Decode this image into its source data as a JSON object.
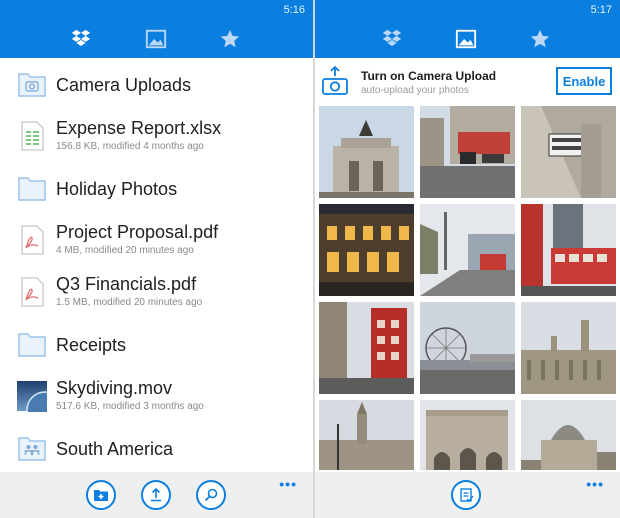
{
  "left": {
    "status_time": "5:16",
    "tabs": [
      {
        "name": "files",
        "icon": "dropbox-icon"
      },
      {
        "name": "photos",
        "icon": "photos-icon"
      },
      {
        "name": "favorites",
        "icon": "star-icon"
      }
    ],
    "files": [
      {
        "name": "Camera Uploads",
        "meta": "",
        "icon": "camera-folder-icon"
      },
      {
        "name": "Expense Report.xlsx",
        "meta": "156.8 KB, modified 4 months ago",
        "icon": "spreadsheet-icon"
      },
      {
        "name": "Holiday Photos",
        "meta": "",
        "icon": "folder-icon"
      },
      {
        "name": "Project Proposal.pdf",
        "meta": "4 MB, modified 20 minutes ago",
        "icon": "pdf-icon"
      },
      {
        "name": "Q3 Financials.pdf",
        "meta": "1.5 MB, modified 20 minutes ago",
        "icon": "pdf-icon"
      },
      {
        "name": "Receipts",
        "meta": "",
        "icon": "folder-icon"
      },
      {
        "name": "Skydiving.mov",
        "meta": "517.6 KB, modified 3 months ago",
        "icon": "video-thumbnail-icon"
      },
      {
        "name": "South America",
        "meta": "",
        "icon": "shared-folder-icon"
      }
    ],
    "app_bar": {
      "buttons": [
        "new-folder-icon",
        "upload-icon",
        "search-icon"
      ],
      "more": "•••"
    }
  },
  "right": {
    "status_time": "5:17",
    "banner": {
      "title": "Turn on Camera Upload",
      "subtitle": "auto-upload your photos",
      "enable_label": "Enable"
    },
    "app_bar": {
      "buttons": [
        "select-icon"
      ],
      "more": "•••"
    }
  },
  "colors": {
    "accent": "#0a7fe0",
    "app_bar": "#efefef",
    "text": "#202020",
    "meta": "#8a8a8a"
  }
}
